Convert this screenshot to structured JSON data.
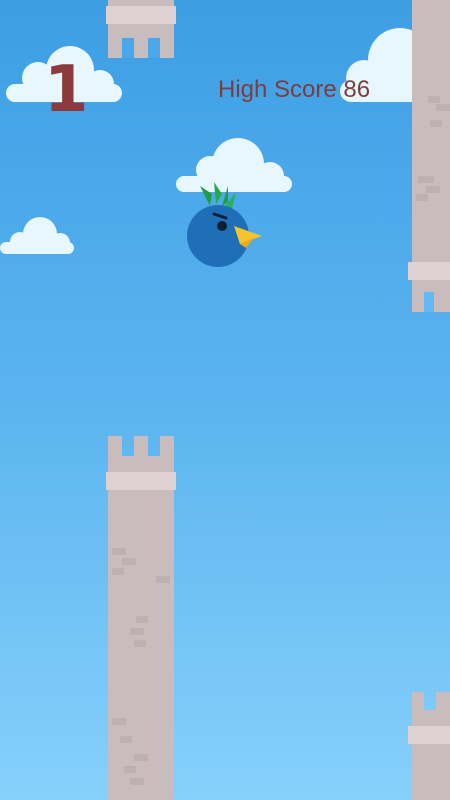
{
  "hud": {
    "score": "1",
    "high_score_label": "High Score",
    "high_score_value": "86"
  },
  "colors": {
    "sky_top": "#3d9ee4",
    "sky_bottom": "#86d0fb",
    "tower": "#c9bcbc",
    "tower_cap": "#ddd1d1",
    "score_text": "#8b3b3b",
    "bird_body": "#1f6fb8",
    "bird_beak": "#f5c32c",
    "bird_crest": "#1e9d45"
  },
  "sprites": {
    "player": "bird-character",
    "obstacles": "castle-tower",
    "background": "clouds"
  }
}
